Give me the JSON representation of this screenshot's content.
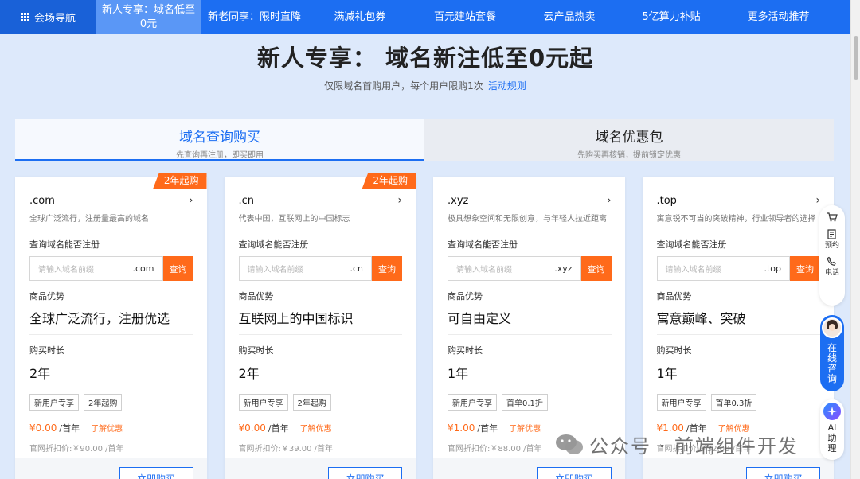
{
  "nav": {
    "home_label": "会场导航",
    "items": [
      {
        "label": "新人专享：域名低至0元"
      },
      {
        "label": "新老同享：限时直降"
      },
      {
        "label": "满减礼包券"
      },
      {
        "label": "百元建站套餐"
      },
      {
        "label": "云产品热卖"
      },
      {
        "label": "5亿算力补贴"
      },
      {
        "label": "更多活动推荐"
      }
    ]
  },
  "hero": {
    "title": "新人专享： 域名新注低至0元起",
    "subtitle": "仅限域名首购用户，每个用户限购1次",
    "rules_link": "活动规则"
  },
  "tabs": [
    {
      "title": "域名查询购买",
      "desc": "先查询再注册，即买即用",
      "active": true
    },
    {
      "title": "域名优惠包",
      "desc": "先购买再核销，提前锁定优惠",
      "active": false
    }
  ],
  "card_labels": {
    "query": "查询域名能否注册",
    "placeholder": "请输入域名前缀",
    "search_btn": "查询",
    "advantage": "商品优势",
    "duration": "购买时长",
    "learn_more": "了解优惠",
    "buy_btn": "立即购买",
    "per_year": "/首年"
  },
  "cards": [
    {
      "badge": "2年起购",
      "domain": ".com",
      "desc": "全球广泛流行，注册量最高的域名",
      "suffix": ".com",
      "advantage": "全球广泛流行，注册优选",
      "duration": "2年",
      "tags": [
        "新用户专享",
        "2年起购"
      ],
      "price": "¥0.00",
      "orig": "官网折扣价:￥90.00 /首年"
    },
    {
      "badge": "2年起购",
      "domain": ".cn",
      "desc": "代表中国，互联网上的中国标志",
      "suffix": ".cn",
      "advantage": "互联网上的中国标识",
      "duration": "2年",
      "tags": [
        "新用户专享",
        "2年起购"
      ],
      "price": "¥0.00",
      "orig": "官网折扣价:￥39.00 /首年"
    },
    {
      "badge": "",
      "domain": ".xyz",
      "desc": "极具想象空间和无限创意，与年轻人拉近距离",
      "suffix": ".xyz",
      "advantage": "可自由定义",
      "duration": "1年",
      "tags": [
        "新用户专享",
        "首单0.1折"
      ],
      "price": "¥1.00",
      "orig": "官网折扣价:￥88.00 /首年"
    },
    {
      "badge": "",
      "domain": ".top",
      "desc": "寓意锐不可当的突破精神，行业领导者的选择",
      "suffix": ".top",
      "advantage": "寓意巅峰、突破",
      "duration": "1年",
      "tags": [
        "新用户专享",
        "首单0.3折"
      ],
      "price": "¥1.00",
      "orig": "官网折扣价:￥32.00 /首年"
    }
  ],
  "float": {
    "reserve": "预约",
    "phone": "电话",
    "consult": "在线咨询",
    "ai": "AI助理"
  },
  "watermark": "公众号 · 前端组件开发",
  "colors": {
    "primary": "#1c6ef2",
    "accent": "#ff6a1a",
    "background": "#dde9fb"
  }
}
